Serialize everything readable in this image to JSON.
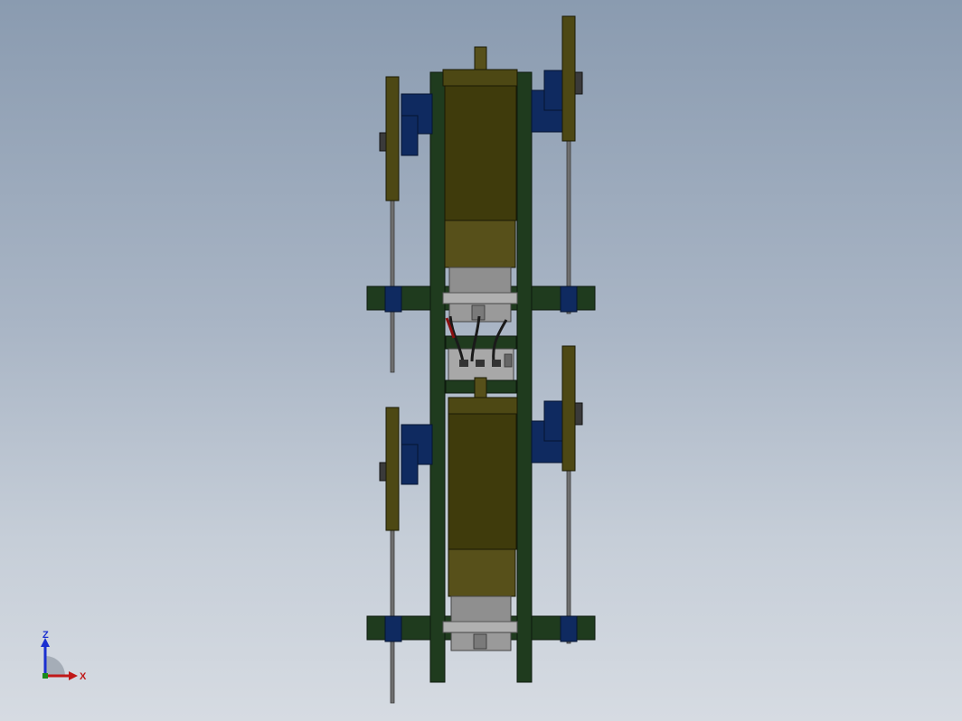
{
  "viewport": {
    "background_top": "#8a9bb0",
    "background_bottom": "#d6dbe2"
  },
  "colors": {
    "frame_green": "#1f3b1e",
    "motor_olive": "#3f3b0c",
    "gearbox_olive": "#57501a",
    "wheel_olive": "#4d4814",
    "servo_blue": "#0f2a60",
    "grey_block": "#8f8f8f",
    "axle_grey": "#6f6f6f",
    "wire_black": "#1a1a1a",
    "wire_red": "#8a1010"
  },
  "triad": {
    "z_label": "Z",
    "x_label": "X",
    "z_color": "#1a2fd0",
    "x_color": "#c01818",
    "origin_color": "#1a8a1a"
  }
}
